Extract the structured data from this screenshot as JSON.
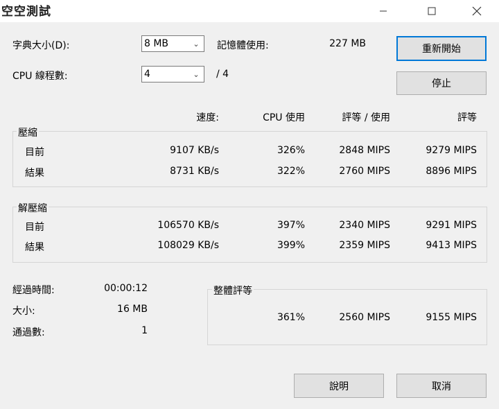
{
  "window": {
    "title": "空空測試"
  },
  "titlebar_icons": {
    "minimize": "minimize-icon",
    "maximize": "maximize-icon",
    "close": "close-icon"
  },
  "settings": {
    "dict_label": "字典大小(D):",
    "dict_value": "8 MB",
    "threads_label": "CPU 線程數:",
    "threads_value": "4",
    "threads_max": "/ 4",
    "memory_label": "記憶體使用:",
    "memory_value": "227 MB"
  },
  "buttons": {
    "restart": "重新開始",
    "stop": "停止",
    "help": "說明",
    "cancel": "取消"
  },
  "columns": [
    "速度:",
    "CPU 使用",
    "評等 / 使用",
    "評等"
  ],
  "compress": {
    "title": "壓縮",
    "rows": [
      {
        "label": "目前",
        "speed": "9107 KB/s",
        "cpu": "326%",
        "rating_usage": "2848 MIPS",
        "rating": "9279 MIPS"
      },
      {
        "label": "結果",
        "speed": "8731 KB/s",
        "cpu": "322%",
        "rating_usage": "2760 MIPS",
        "rating": "8896 MIPS"
      }
    ]
  },
  "decompress": {
    "title": "解壓縮",
    "rows": [
      {
        "label": "目前",
        "speed": "106570 KB/s",
        "cpu": "397%",
        "rating_usage": "2340 MIPS",
        "rating": "9291 MIPS"
      },
      {
        "label": "結果",
        "speed": "108029 KB/s",
        "cpu": "399%",
        "rating_usage": "2359 MIPS",
        "rating": "9413 MIPS"
      }
    ]
  },
  "stats": {
    "elapsed_label": "經過時間:",
    "elapsed_value": "00:00:12",
    "size_label": "大小:",
    "size_value": "16 MB",
    "passes_label": "通過數:",
    "passes_value": "1"
  },
  "overall": {
    "title": "整體評等",
    "cpu": "361%",
    "rating_usage": "2560 MIPS",
    "rating": "9155 MIPS"
  }
}
